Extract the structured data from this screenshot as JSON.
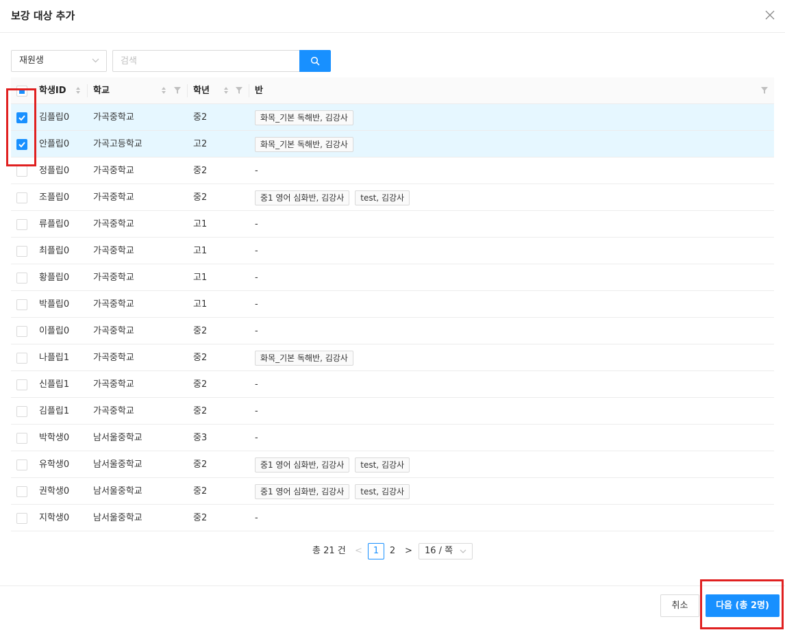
{
  "modal": {
    "title": "보강 대상 추가",
    "close_icon": "close-icon"
  },
  "filter": {
    "select_value": "재원생",
    "search_placeholder": "검색",
    "search_icon": "search-icon"
  },
  "table": {
    "columns": [
      "학생ID",
      "학교",
      "학년",
      "반"
    ],
    "rows": [
      {
        "checked": true,
        "id": "김플립0",
        "school": "가곡중학교",
        "grade": "중2",
        "classes": [
          "화목_기본 독해반, 김강사"
        ]
      },
      {
        "checked": true,
        "id": "안플립0",
        "school": "가곡고등학교",
        "grade": "고2",
        "classes": [
          "화목_기본 독해반, 김강사"
        ]
      },
      {
        "checked": false,
        "id": "정플립0",
        "school": "가곡중학교",
        "grade": "중2",
        "classes": [],
        "empty": "-"
      },
      {
        "checked": false,
        "id": "조플립0",
        "school": "가곡중학교",
        "grade": "중2",
        "classes": [
          "중1 영어 심화반, 김강사",
          "test, 김강사"
        ]
      },
      {
        "checked": false,
        "id": "류플립0",
        "school": "가곡중학교",
        "grade": "고1",
        "classes": [],
        "empty": "-"
      },
      {
        "checked": false,
        "id": "최플립0",
        "school": "가곡중학교",
        "grade": "고1",
        "classes": [],
        "empty": "-"
      },
      {
        "checked": false,
        "id": "황플립0",
        "school": "가곡중학교",
        "grade": "고1",
        "classes": [],
        "empty": "-"
      },
      {
        "checked": false,
        "id": "박플립0",
        "school": "가곡중학교",
        "grade": "고1",
        "classes": [],
        "empty": "-"
      },
      {
        "checked": false,
        "id": "이플립0",
        "school": "가곡중학교",
        "grade": "중2",
        "classes": [],
        "empty": "-"
      },
      {
        "checked": false,
        "id": "나플립1",
        "school": "가곡중학교",
        "grade": "중2",
        "classes": [
          "화목_기본 독해반, 김강사"
        ]
      },
      {
        "checked": false,
        "id": "신플립1",
        "school": "가곡중학교",
        "grade": "중2",
        "classes": [],
        "empty": "-"
      },
      {
        "checked": false,
        "id": "김플립1",
        "school": "가곡중학교",
        "grade": "중2",
        "classes": [],
        "empty": "-"
      },
      {
        "checked": false,
        "id": "박학생0",
        "school": "남서울중학교",
        "grade": "중3",
        "classes": [],
        "empty": "-"
      },
      {
        "checked": false,
        "id": "유학생0",
        "school": "남서울중학교",
        "grade": "중2",
        "classes": [
          "중1 영어 심화반, 김강사",
          "test, 김강사"
        ]
      },
      {
        "checked": false,
        "id": "권학생0",
        "school": "남서울중학교",
        "grade": "중2",
        "classes": [
          "중1 영어 심화반, 김강사",
          "test, 김강사"
        ]
      },
      {
        "checked": false,
        "id": "지학생0",
        "school": "남서울중학교",
        "grade": "중2",
        "classes": [],
        "empty": "-"
      }
    ]
  },
  "pagination": {
    "total": "총 21 건",
    "prev": "<",
    "pages": [
      "1",
      "2"
    ],
    "current": "1",
    "next": ">",
    "page_size": "16 / 쪽"
  },
  "footer": {
    "cancel_label": "취소",
    "next_label": "다음 (총 2명)"
  },
  "colors": {
    "primary": "#1890ff",
    "selected_row": "#e6f7ff",
    "highlight": "#e02020"
  }
}
